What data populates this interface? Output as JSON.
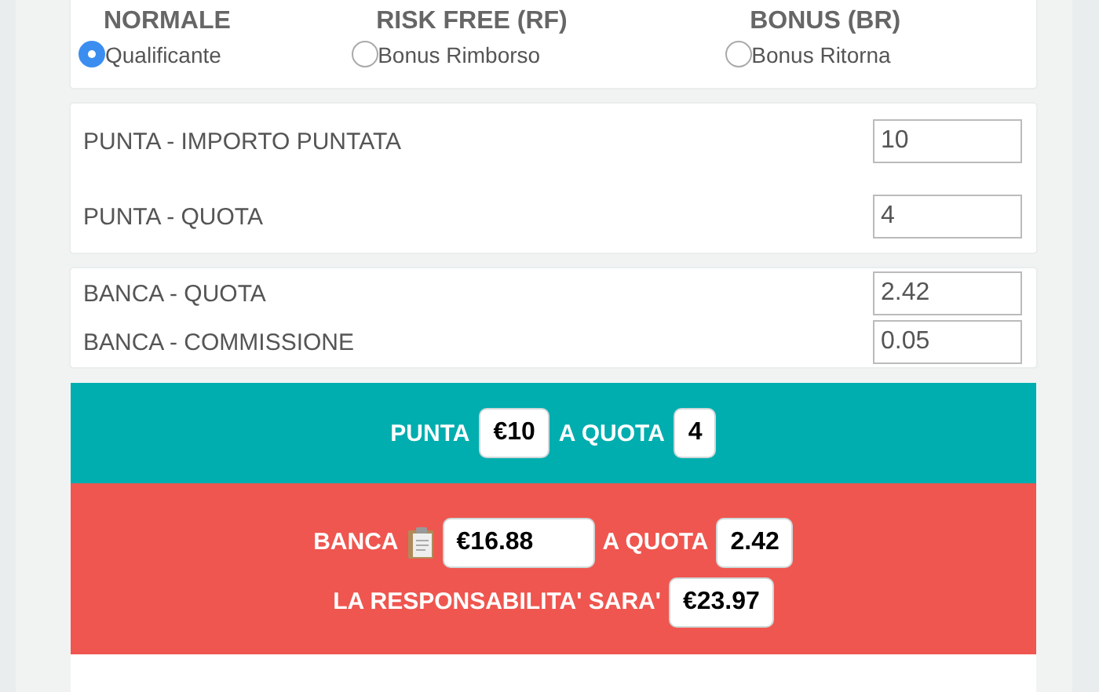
{
  "bet_types": [
    {
      "title": "NORMALE",
      "option": "Qualificante",
      "selected": true
    },
    {
      "title": "RISK FREE (RF)",
      "option": "Bonus Rimborso",
      "selected": false
    },
    {
      "title": "BONUS (BR)",
      "option": "Bonus Ritorna",
      "selected": false
    }
  ],
  "punta_fields": [
    {
      "label": "PUNTA - IMPORTO PUNTATA",
      "value": "10"
    },
    {
      "label": "PUNTA - QUOTA",
      "value": "4"
    }
  ],
  "banca_fields": [
    {
      "label": "BANCA - QUOTA",
      "value": "2.42"
    },
    {
      "label": "BANCA - COMMISSIONE",
      "value": "0.05"
    }
  ],
  "punta_result": {
    "prefix": "PUNTA",
    "amount": "€10",
    "middle": "A QUOTA",
    "odds": "4"
  },
  "banca_result": {
    "prefix": "BANCA",
    "amount": "€16.88",
    "middle": "A QUOTA",
    "odds": "2.42",
    "liability_label": "LA RESPONSABILITA' SARA'",
    "liability": "€23.97"
  }
}
